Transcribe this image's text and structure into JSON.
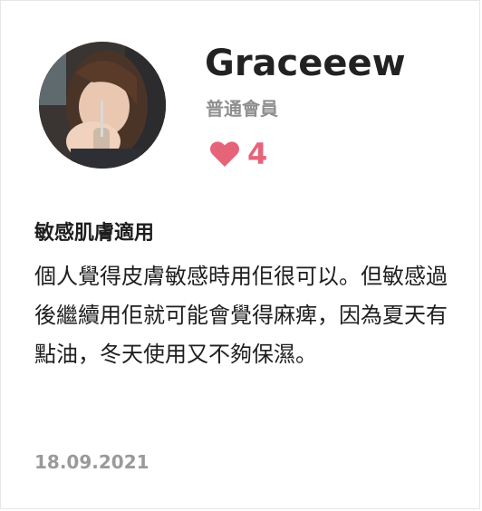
{
  "review": {
    "author": {
      "name": "Graceeew",
      "level": "普通會員",
      "likes": "4"
    },
    "title": "敏感肌膚適用",
    "body": "個人覺得皮膚敏感時用佢很可以。但敏感過後繼續用佢就可能會覺得麻痺，因為夏天有點油，冬天使用又不夠保濕。",
    "date": "18.09.2021"
  },
  "colors": {
    "heart": "#e5647a",
    "muted": "#9a9a9a",
    "text": "#1e1e1e"
  },
  "icons": {
    "like": "heart-icon"
  }
}
